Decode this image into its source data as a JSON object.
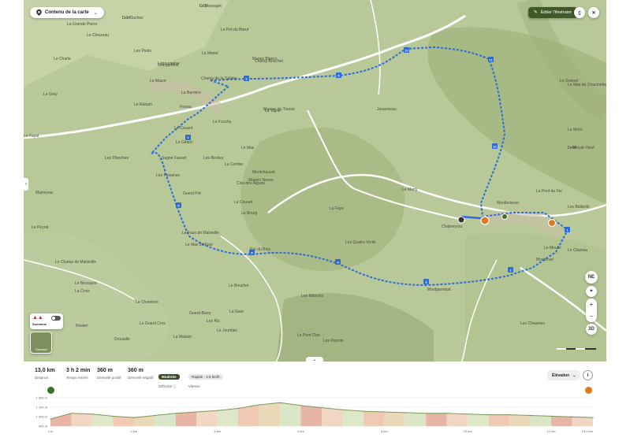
{
  "topbar": {
    "route_selector_label": "Contenu de la carte",
    "edit_button_label": "Éditer l'itinéraire"
  },
  "map": {
    "compass_label": "NE",
    "view_3d_label": "3D",
    "zoom_in_label": "+",
    "zoom_out_label": "−",
    "layers_label": "Sommets",
    "basemap_label": "Classique",
    "route_color": "#2f6bd6",
    "start_marker_color": "#e07a1f",
    "place_labels": [
      "Le Bessaget",
      "Les Ouches",
      "La Grande Pierre",
      "Le Clouzeau",
      "Le Pré du Bœuf",
      "Les Pieds",
      "Le Charle",
      "Labournaise",
      "Le Mazet",
      "Champ Bouchet",
      "Marais Blancs",
      "Le Mazot",
      "Le Grey",
      "La Barrière",
      "Le Rabain",
      "Grangefond",
      "Champ de la Tuilière",
      "Forsac",
      "Le Fouchy",
      "Le Couard",
      "Le Girard",
      "La Vigne",
      "Marsac du Tresse",
      "Jouanneau",
      "Les Planches",
      "Sagne Fauvet",
      "Les Bordes",
      "Le Mas",
      "La Combe",
      "Montchauvet",
      "Maison Neuve",
      "Les Pesaines",
      "Clos des Aigues",
      "Grand Pré",
      "Le Couard",
      "Le Bourg",
      "La Faye",
      "Le Marty",
      "Montgarnaud",
      "Montboissier",
      "Le Moulin",
      "Les Chaumes",
      "Le Peyrat",
      "Le Faux de Malvieille",
      "Le Mas du Four",
      "Pré du Bois",
      "Malveyrac",
      "Le Champ de Malvieille",
      "Le Bessayre",
      "La Croix",
      "Le Bouchet",
      "Le Chambon",
      "Grand-Barry",
      "Les Ris",
      "Rivalet",
      "Drouaille",
      "Le Grand Cros",
      "La Maison",
      "Le Jourdain",
      "La Gare",
      "Le Pont Clos",
      "Les Maisons",
      "Les Parrots",
      "Les Quatre Vents",
      "Le Pont du Fer",
      "Le Gonnet",
      "Les Ballards",
      "Le Mas de Chaumette",
      "Le Mont",
      "Le Moulin Neuf",
      "Le Cluzeau",
      "Chabreyrou",
      "Le Fayat",
      "Montrevel",
      "D 44",
      "D 57",
      "D 14"
    ]
  },
  "stats": {
    "distance_value": "13,0 km",
    "distance_label": "Distance",
    "duration_value": "3 h 2 min",
    "duration_label": "Temps estimé",
    "ascent_value": "360 m",
    "ascent_label": "Dénivelé positif",
    "descent_value": "360 m",
    "descent_label": "Dénivelé négatif",
    "difficulty_value": "Modérée",
    "difficulty_label": "Difficulté ⓘ",
    "speed_value": "Rapide · 4,5 km/h",
    "speed_label": "Vitesse",
    "profile_mode_label": "Élévation",
    "info_icon_label": "i"
  },
  "chart_data": {
    "type": "area",
    "title": "",
    "xlabel": "",
    "ylabel": "",
    "ytick_labels": [
      "1 300 m",
      "1 200 m",
      "1 000 m",
      "900 m"
    ],
    "xtick_labels": [
      "0 m",
      "2 km",
      "4 km",
      "6 km",
      "8 km",
      "10 km",
      "12 km",
      "13,0 km"
    ],
    "xlim": [
      0,
      13.0
    ],
    "ylim": [
      900,
      1300
    ],
    "x": [
      0,
      0.5,
      1,
      1.5,
      2,
      2.5,
      3,
      3.5,
      4,
      4.5,
      5,
      5.5,
      6,
      6.5,
      7,
      7.5,
      8,
      8.5,
      9,
      9.5,
      10,
      10.5,
      11,
      11.5,
      12,
      12.5,
      13
    ],
    "values": [
      1000,
      1080,
      1070,
      1040,
      1020,
      1050,
      1080,
      1100,
      1120,
      1150,
      1200,
      1230,
      1190,
      1160,
      1130,
      1110,
      1100,
      1090,
      1080,
      1080,
      1070,
      1060,
      1060,
      1050,
      1040,
      1030,
      1020
    ]
  }
}
